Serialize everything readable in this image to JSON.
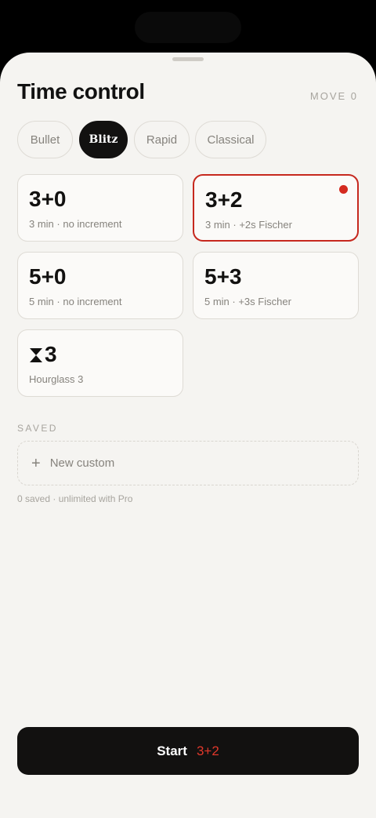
{
  "header": {
    "title": "Time control",
    "move_label": "MOVE 0"
  },
  "tabs": [
    {
      "label": "Bullet",
      "active": false
    },
    {
      "label": "Blitz",
      "active": true
    },
    {
      "label": "Rapid",
      "active": false
    },
    {
      "label": "Classical",
      "active": false
    }
  ],
  "presets": [
    {
      "big": "3+0",
      "sub": "3 min · no increment",
      "selected": false
    },
    {
      "big": "3+2",
      "sub": "3 min · +2s Fischer",
      "selected": true
    },
    {
      "big": "5+0",
      "sub": "5 min · no increment",
      "selected": false
    },
    {
      "big": "5+3",
      "sub": "5 min · +3s Fischer",
      "selected": false
    },
    {
      "big": "3",
      "sub": "Hourglass 3",
      "icon": "hourglass-icon",
      "selected": false
    }
  ],
  "saved": {
    "section_label": "SAVED",
    "new_custom_label": "New custom",
    "plus_icon": "plus-icon",
    "note": "0 saved · unlimited with Pro"
  },
  "start_button": {
    "label": "Start",
    "value": "3+2"
  },
  "colors": {
    "accent": "#d42a1f",
    "dark": "#121110",
    "background": "#f5f4f1"
  }
}
